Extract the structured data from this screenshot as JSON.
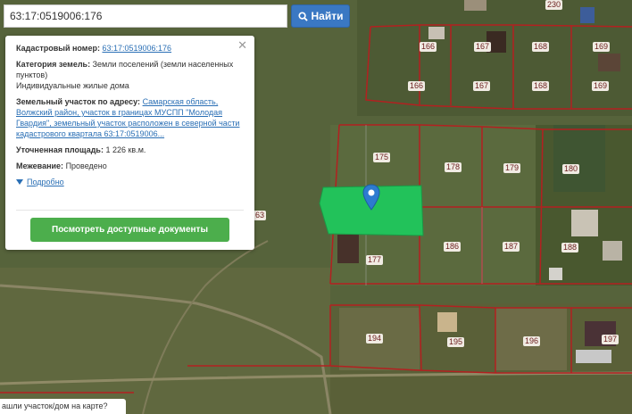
{
  "search": {
    "value": "63:17:0519006:176",
    "button_label": "Найти"
  },
  "panel": {
    "cadastral_label": "Кадастровый номер:",
    "cadastral_value": "63:17:0519006:176",
    "category_label": "Категория земель:",
    "category_value": "Земли поселений (земли населенных пунктов)",
    "use_value": "Индивидуальные жилые дома",
    "address_label": "Земельный участок по адресу:",
    "address_value": "Самарская область, Волжский район, участок в границах МУСПП \"Молодая Гвардия\", земельный участок расположен в северной части кадастрового квартала 63:17:0519006...",
    "area_label": "Уточненная площадь:",
    "area_value": "1 226 кв.м.",
    "survey_label": "Межевание:",
    "survey_value": "Проведено",
    "more_label": "Подробно",
    "docs_button": "Посмотреть доступные документы"
  },
  "map": {
    "plot_labels": [
      "166",
      "167",
      "168",
      "169",
      "175",
      "178",
      "179",
      "180",
      "177",
      "186",
      "187",
      "188",
      "194",
      "195",
      "196",
      "197",
      "63",
      "230"
    ]
  },
  "bottom_tip": "ашли участок/дом на карте?",
  "colors": {
    "highlight": "#22c25a",
    "boundary": "#b32020",
    "accent": "#3a78c3",
    "button_green": "#4cae4c"
  }
}
